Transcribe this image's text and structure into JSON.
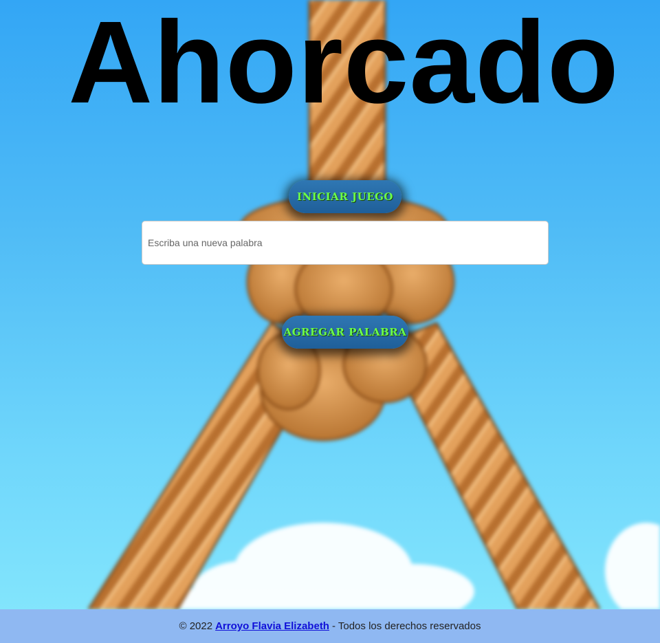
{
  "page": {
    "title": "Ahorcado"
  },
  "buttons": {
    "start_label": "INICIAR JUEGO",
    "add_label": "AGREGAR PALABRA"
  },
  "word_input": {
    "placeholder": "Escriba una nueva palabra",
    "value": ""
  },
  "footer": {
    "copyright": "© 2022",
    "author_link": "Arroyo Flavia Elizabeth",
    "rights": "- Todos los derechos reservados"
  },
  "colors": {
    "sky_top": "#33a6f5",
    "sky_bottom": "#86e8fd",
    "rope": "#d99550",
    "button_bg": "#1f5f99",
    "button_text": "#6cff4a",
    "footer_bg": "#8fb8f2",
    "link": "#1010d8"
  },
  "icons": {
    "background": "noose-rope-illustration"
  }
}
